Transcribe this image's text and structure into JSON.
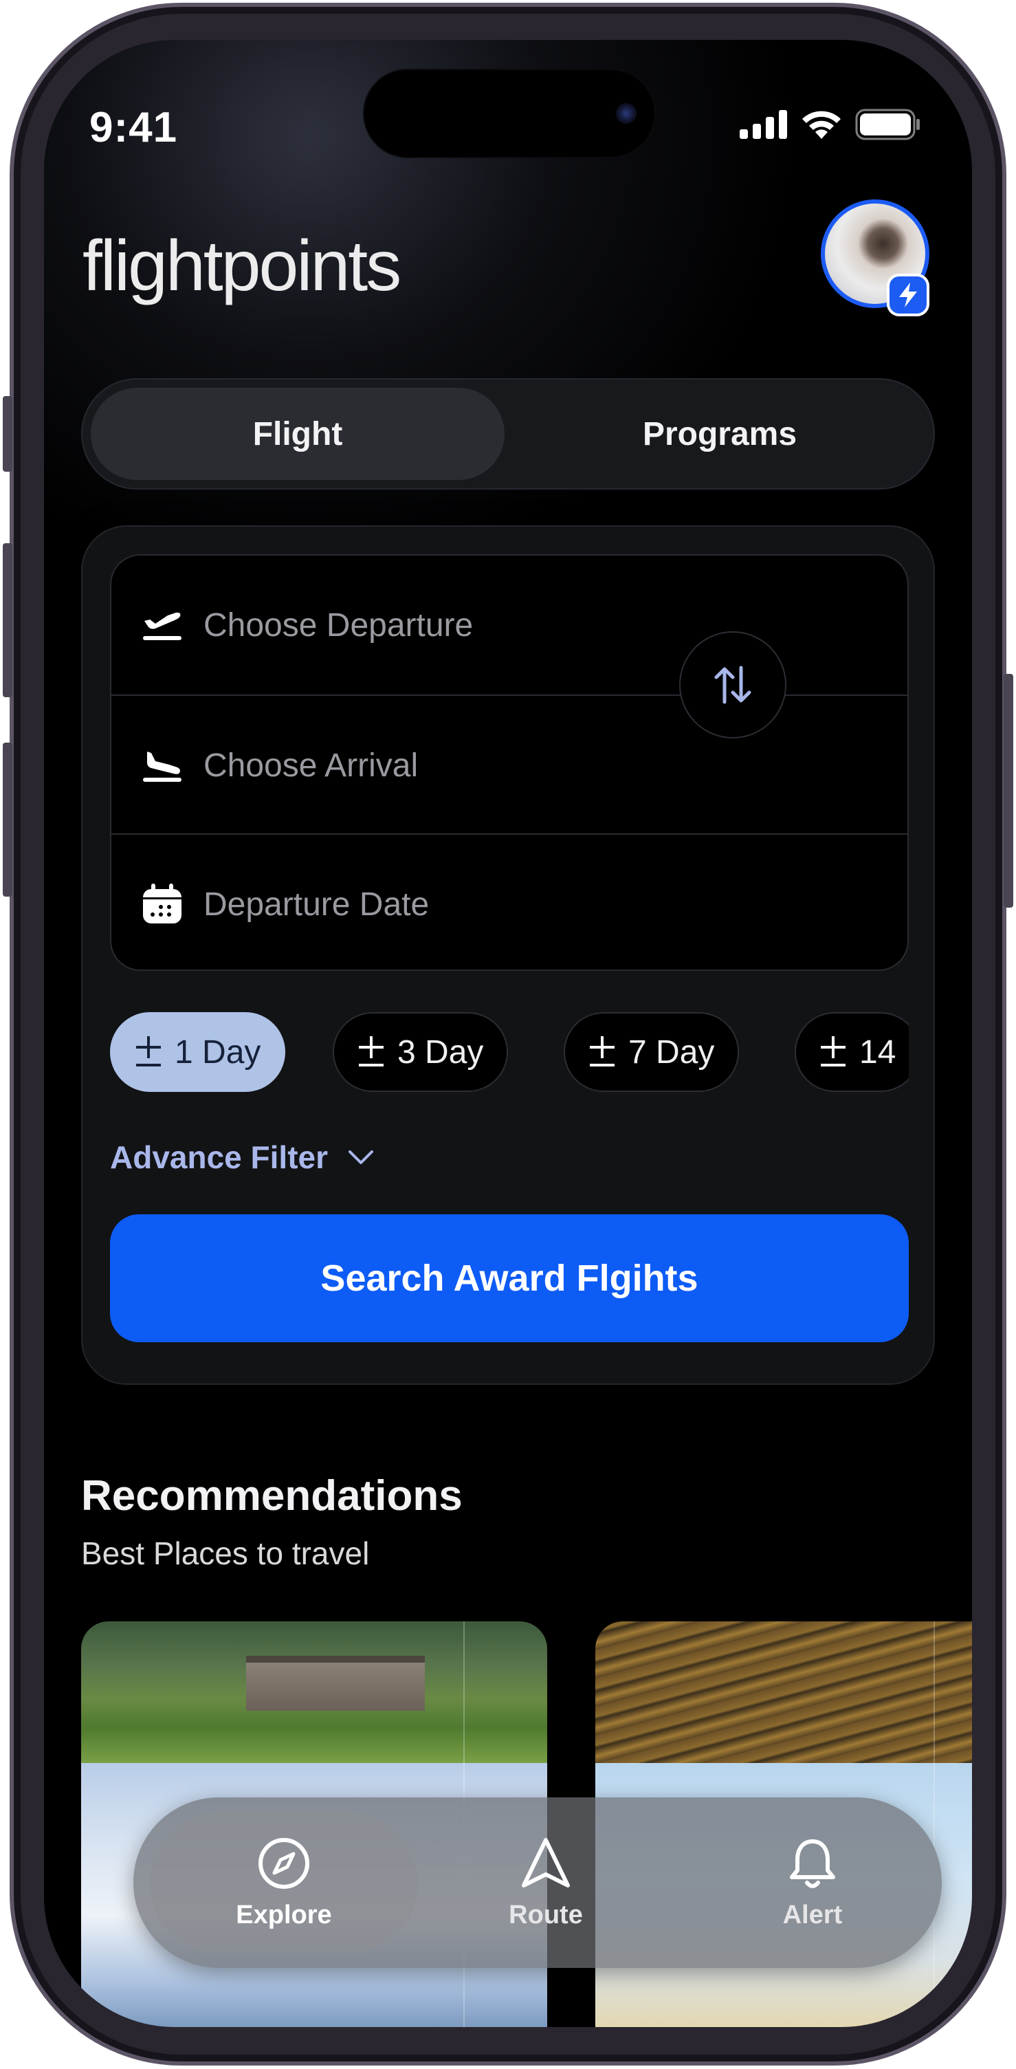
{
  "status_bar": {
    "time": "9:41"
  },
  "header": {
    "logo": "flightpoints"
  },
  "segmented": {
    "tabs": [
      {
        "label": "Flight",
        "active": true
      },
      {
        "label": "Programs",
        "active": false
      }
    ]
  },
  "search_form": {
    "departure_placeholder": "Choose Departure",
    "arrival_placeholder": "Choose Arrival",
    "date_placeholder": "Departure Date",
    "chips": [
      {
        "label": "1 Day",
        "active": true
      },
      {
        "label": "3 Day",
        "active": false
      },
      {
        "label": "7 Day",
        "active": false
      },
      {
        "label": "14",
        "active": false
      }
    ],
    "advance_filter": "Advance Filter",
    "search_button": "Search Award Flgihts"
  },
  "recommendations": {
    "title": "Recommendations",
    "subtitle": "Best Places to travel"
  },
  "tabbar": {
    "items": [
      {
        "label": "Explore",
        "icon": "compass-icon",
        "active": true
      },
      {
        "label": "Route",
        "icon": "navigation-arrow-icon",
        "active": false
      },
      {
        "label": "Alert",
        "icon": "bell-icon",
        "active": false
      }
    ]
  },
  "colors": {
    "accent": "#0e5cf6",
    "chip_active": "#aec3e6",
    "filter_text": "#a9b7ea",
    "background": "#000000"
  }
}
